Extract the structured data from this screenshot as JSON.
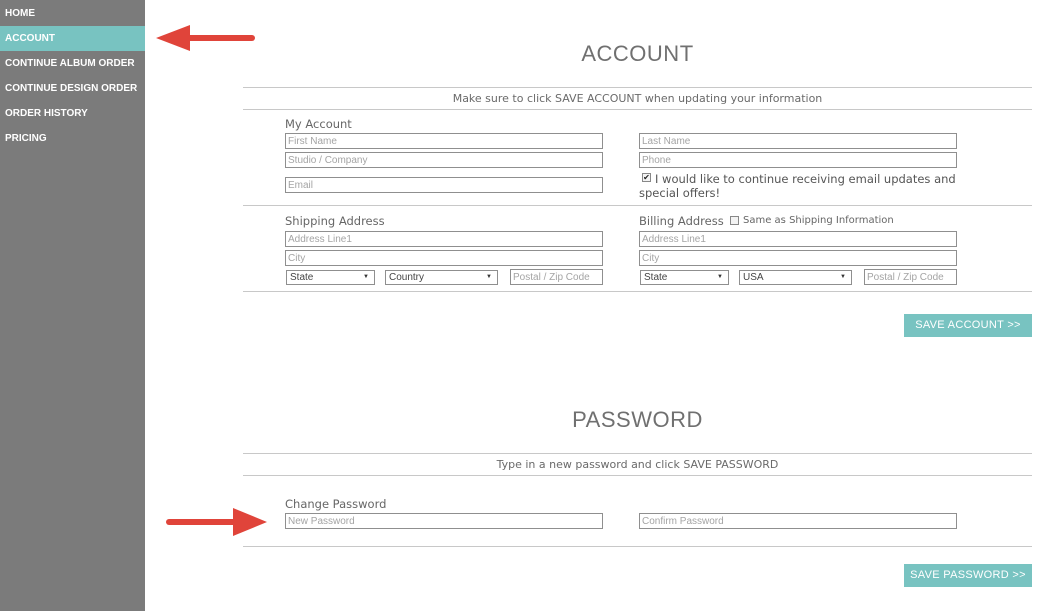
{
  "sidebar": {
    "items": [
      {
        "label": "HOME"
      },
      {
        "label": "ACCOUNT"
      },
      {
        "label": "CONTINUE ALBUM ORDER"
      },
      {
        "label": "CONTINUE DESIGN ORDER"
      },
      {
        "label": "ORDER HISTORY"
      },
      {
        "label": "PRICING"
      }
    ],
    "active_index": 1,
    "bg_color": "#7b7b7b",
    "active_color": "#78c3c1"
  },
  "account": {
    "title": "ACCOUNT",
    "info": "Make sure to click SAVE ACCOUNT when updating your information",
    "my_account_label": "My Account",
    "first_name": {
      "value": "",
      "placeholder": "First Name"
    },
    "last_name": {
      "value": "",
      "placeholder": "Last Name"
    },
    "studio": {
      "value": "",
      "placeholder": "Studio / Company"
    },
    "phone": {
      "value": "",
      "placeholder": "Phone"
    },
    "email": {
      "value": "",
      "placeholder": "Email"
    },
    "email_updates": {
      "checked": true,
      "label_line1": "I would like to continue receiving email updates and",
      "label_line2": "special offers!"
    },
    "shipping": {
      "label": "Shipping Address",
      "address": {
        "value": "",
        "placeholder": "Address Line1"
      },
      "city": {
        "value": "",
        "placeholder": "City"
      },
      "state": "State",
      "country": "Country",
      "zip": {
        "value": "",
        "placeholder": "Postal / Zip Code"
      }
    },
    "billing": {
      "label": "Billing Address",
      "same_as_shipping": {
        "checked": false,
        "label": "Same as Shipping Information"
      },
      "address": {
        "value": "",
        "placeholder": "Address Line1"
      },
      "city": {
        "value": "",
        "placeholder": "City"
      },
      "state": "State",
      "country": "USA",
      "zip": {
        "value": "",
        "placeholder": "Postal / Zip Code"
      }
    },
    "save_label": "SAVE ACCOUNT >>"
  },
  "password": {
    "title": "PASSWORD",
    "info": "Type in a new password and click SAVE PASSWORD",
    "change_label": "Change Password",
    "new_password": {
      "value": "",
      "placeholder": "New Password"
    },
    "confirm_password": {
      "value": "",
      "placeholder": "Confirm Password"
    },
    "save_label": "SAVE PASSWORD >>"
  },
  "colors": {
    "accent": "#78c3c1",
    "annotation_arrow": "#e0443a"
  }
}
